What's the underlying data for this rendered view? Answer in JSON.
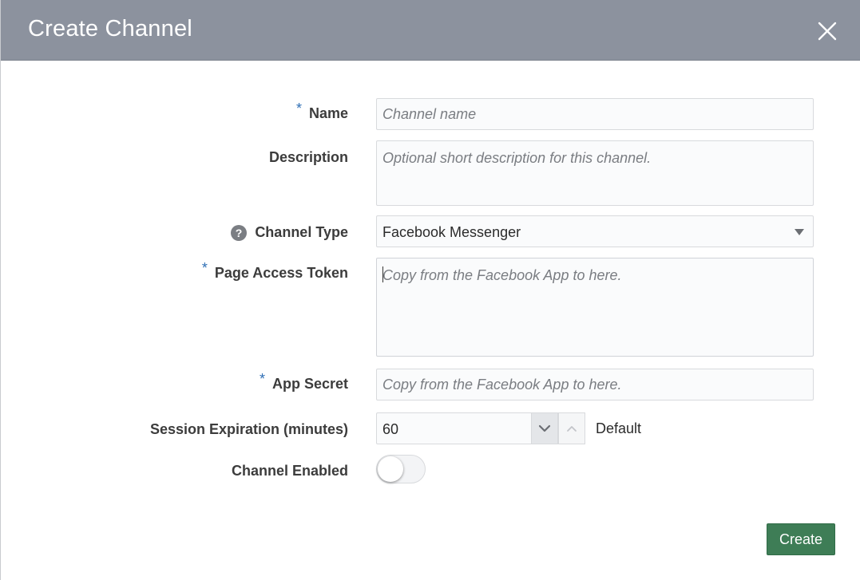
{
  "dialog": {
    "title": "Create Channel",
    "close_icon": "close-icon"
  },
  "form": {
    "required_marker": "*",
    "name": {
      "label": "Name",
      "placeholder": "Channel name",
      "value": ""
    },
    "description": {
      "label": "Description",
      "placeholder": "Optional short description for this channel.",
      "value": ""
    },
    "channel_type": {
      "label": "Channel Type",
      "help_icon": "help-icon",
      "help_glyph": "?",
      "value": "Facebook Messenger"
    },
    "page_access_token": {
      "label": "Page Access Token",
      "placeholder": "Copy from the Facebook App to here.",
      "value": ""
    },
    "app_secret": {
      "label": "App Secret",
      "placeholder": "Copy from the Facebook App to here.",
      "value": ""
    },
    "session_expiration": {
      "label": "Session Expiration (minutes)",
      "value": "60",
      "default_label": "Default"
    },
    "channel_enabled": {
      "label": "Channel Enabled",
      "enabled": false
    }
  },
  "actions": {
    "create_label": "Create"
  },
  "colors": {
    "header_bg": "#8c929e",
    "required_marker": "#2f6fb5",
    "create_button": "#3e7d56"
  }
}
